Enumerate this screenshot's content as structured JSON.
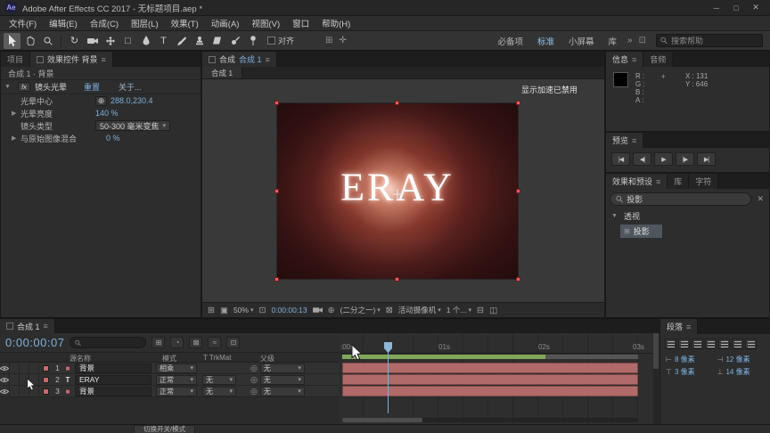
{
  "titlebar": {
    "app_badge": "Ae",
    "title": "Adobe After Effects CC 2017 - 无标题项目.aep *"
  },
  "menubar": [
    "文件(F)",
    "编辑(E)",
    "合成(C)",
    "图层(L)",
    "效果(T)",
    "动画(A)",
    "视图(V)",
    "窗口",
    "帮助(H)"
  ],
  "toolbar": {
    "align_label": "对齐",
    "workspaces": [
      "必备项",
      "标准",
      "小屏幕",
      "库"
    ],
    "search_placeholder": "搜索帮助"
  },
  "effect_controls": {
    "tab_project": "项目",
    "tab_title": "效果控件 背景",
    "breadcrumb": "合成 1 · 背景",
    "effect_badge": "fx",
    "effect_name": "镜头光晕",
    "reset_label": "重置",
    "about_label": "关于...",
    "props": [
      {
        "label": "光晕中心",
        "value": "288.0,230.4"
      },
      {
        "label": "光晕亮度",
        "value": "140 %"
      },
      {
        "label": "镜头类型",
        "value": "50-300 毫米变焦"
      },
      {
        "label": "与原始图像混合",
        "value": "0 %"
      }
    ]
  },
  "composition": {
    "panel_label": "合成",
    "comp_tab": "合成 1",
    "viewer_tab": "合成 1",
    "notice": "显示加速已禁用",
    "canvas_text": "ERAY",
    "zoom_value": "50%",
    "timecode": "0:00:00:13",
    "resolution": "(二分之一)",
    "camera_view": "活动摄像机",
    "view_count": "1 个..."
  },
  "info_panel": {
    "tab_info": "信息",
    "tab_audio": "音频",
    "r": "R :",
    "g": "G :",
    "b": "B :",
    "a": "A :",
    "x": "X : 131",
    "y": "Y : 646"
  },
  "preview_panel": {
    "title": "预览"
  },
  "effects_presets": {
    "title": "效果和预设",
    "tab_library": "库",
    "tab_character": "字符",
    "search_value": "投影",
    "group_label": "透视",
    "item_label": "投影"
  },
  "timeline": {
    "tab": "合成 1",
    "timecode": "0:00:00:07",
    "columns": {
      "source": "源名称",
      "mode": "模式",
      "trkmat": "T TrkMat",
      "parent": "父级"
    },
    "layers": [
      {
        "num": "1",
        "type_glyph": "■",
        "name": "背景",
        "mode": "相乘",
        "trkmat": "",
        "parent": "无"
      },
      {
        "num": "2",
        "type_glyph": "T",
        "name": "ERAY",
        "mode": "正常",
        "trkmat": "无",
        "parent": "无"
      },
      {
        "num": "3",
        "type_glyph": "■",
        "name": "背景",
        "mode": "正常",
        "trkmat": "无",
        "parent": "无"
      }
    ],
    "ruler": [
      ":00s",
      "01s",
      "02s",
      "03s"
    ]
  },
  "paragraph_panel": {
    "title": "段落",
    "fields": [
      "8 像素",
      "12 像素",
      "3 像素",
      "14 像素"
    ]
  },
  "statusbar": {
    "toggle_label": "切换开关/模式"
  },
  "colors": {
    "accent_blue": "#7eb0dc",
    "layer_bar_red": "#b06a6a",
    "work_area_green": "#7fa85a",
    "handle_red": "#ff5b5b"
  }
}
